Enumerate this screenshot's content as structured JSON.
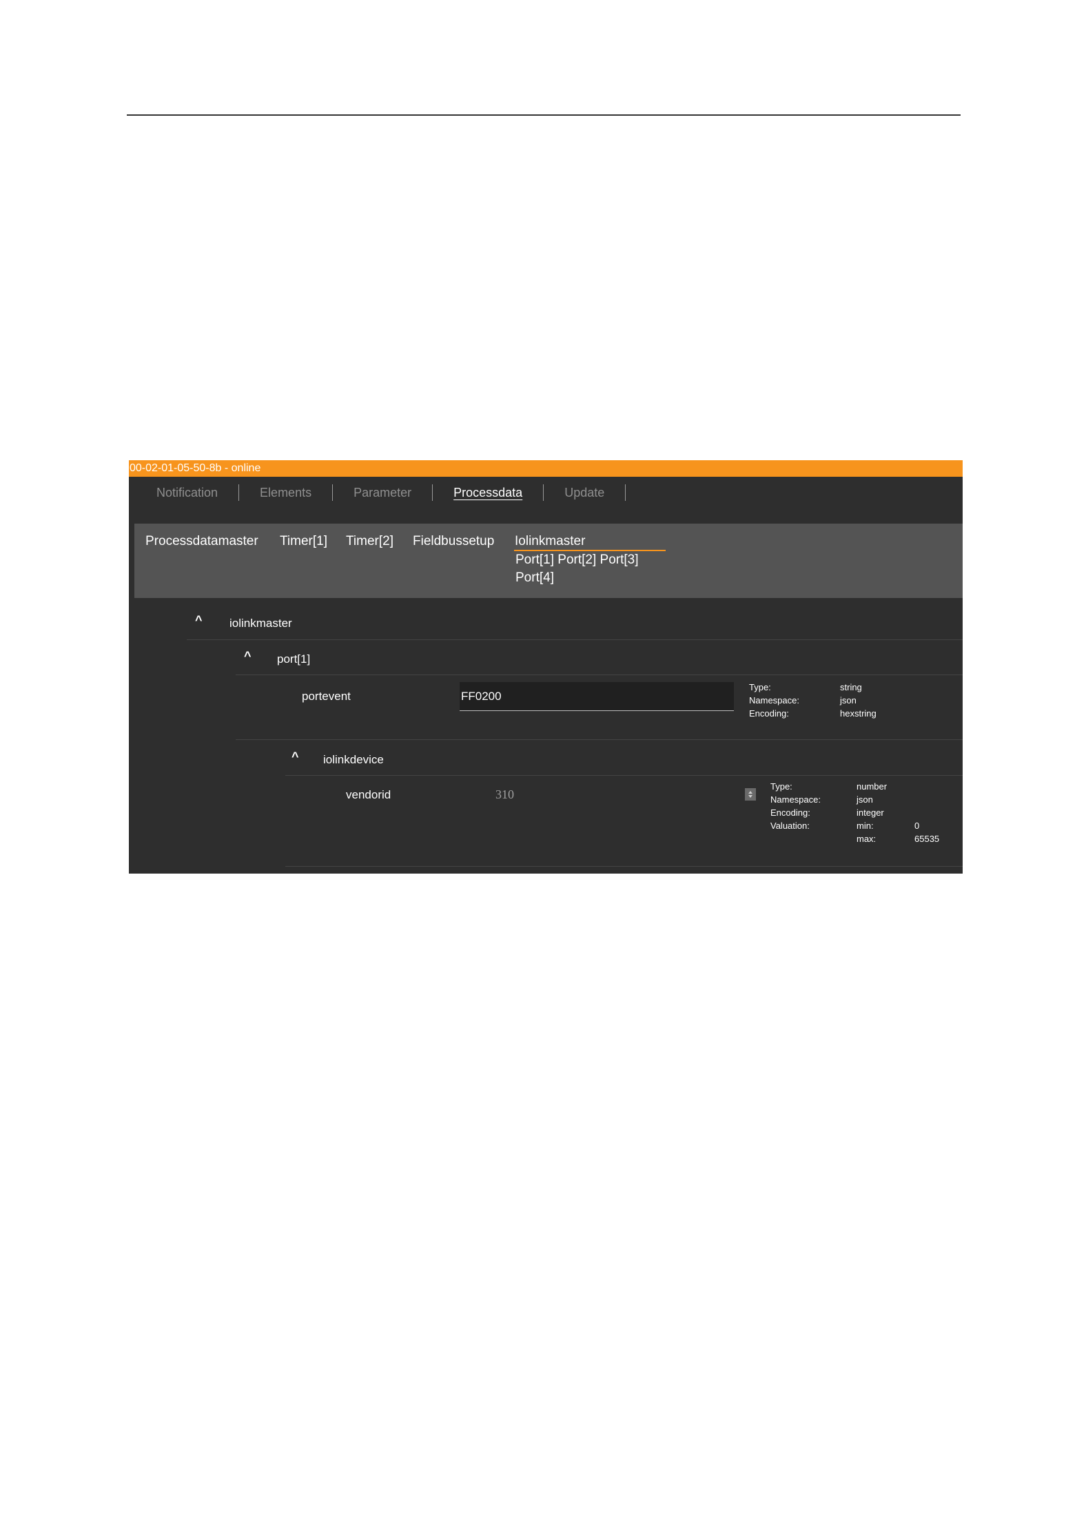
{
  "titlebar": {
    "text": "00-02-01-05-50-8b - online",
    "color": "#f7941d"
  },
  "tabs": [
    {
      "label": "Notification",
      "active": false
    },
    {
      "label": "Elements",
      "active": false
    },
    {
      "label": "Parameter",
      "active": false
    },
    {
      "label": "Processdata",
      "active": true
    },
    {
      "label": "Update",
      "active": false
    }
  ],
  "subnav": {
    "items": [
      "Processdatamaster",
      "Timer[1]",
      "Timer[2]",
      "Fieldbussetup"
    ],
    "group": {
      "label": "Iolinkmaster",
      "ports": [
        "Port[1]",
        "Port[2]",
        "Port[3]",
        "Port[4]"
      ]
    }
  },
  "tree": {
    "iolinkmaster": {
      "caret": "^",
      "label": "iolinkmaster"
    },
    "port1": {
      "caret": "^",
      "label": "port[1]"
    },
    "portevent": {
      "label": "portevent",
      "value": "FF0200",
      "meta": {
        "type_label": "Type:",
        "type": "string",
        "namespace_label": "Namespace:",
        "namespace": "json",
        "encoding_label": "Encoding:",
        "encoding": "hexstring"
      }
    },
    "iolinkdevice": {
      "caret": "^",
      "label": "iolinkdevice"
    },
    "vendorid": {
      "label": "vendorid",
      "value": "310",
      "meta": {
        "type_label": "Type:",
        "type": "number",
        "namespace_label": "Namespace:",
        "namespace": "json",
        "encoding_label": "Encoding:",
        "encoding": "integer",
        "valuation_label": "Valuation:",
        "min_label": "min:",
        "min": "0",
        "max_label": "max:",
        "max": "65535"
      }
    }
  }
}
